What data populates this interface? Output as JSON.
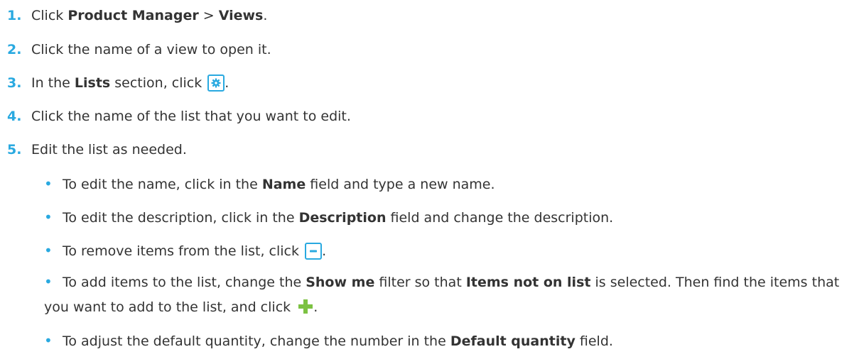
{
  "steps": [
    {
      "num": "1.",
      "text1": "Click ",
      "b1": "Product Manager",
      "text2": " > ",
      "b2": "Views",
      "text3": "."
    },
    {
      "num": "2.",
      "text": "Click the name of a view to open it."
    },
    {
      "num": "3.",
      "text1": "In the ",
      "b1": "Lists",
      "text2": " section, click ",
      "text3": "."
    },
    {
      "num": "4.",
      "text": "Click the name of the list that you want to edit."
    },
    {
      "num": "5.",
      "text": "Edit the list as needed."
    }
  ],
  "bullets": [
    {
      "text1": "To edit the name, click in the ",
      "b1": "Name",
      "text2": " field and type a new name."
    },
    {
      "text1": "To edit the description, click in the ",
      "b1": "Description",
      "text2": " field and change the description."
    },
    {
      "text1": "To remove items from the list, click ",
      "text2": "."
    },
    {
      "text1": "To add items to the list, change the ",
      "b1": "Show me",
      "text2": " filter so that ",
      "b2": "Items not on list",
      "text3": " is selected. Then find the items that you want to add to the list, and click ",
      "text4": "."
    },
    {
      "text1": "To adjust the default quantity, change the number in the ",
      "b1": "Default quantity",
      "text2": " field."
    }
  ],
  "bullet_char": "•",
  "icons": {
    "gear": "gear-icon",
    "minus": "minus-icon",
    "plus": "plus-icon"
  },
  "colors": {
    "accent": "#29a9e0",
    "plus": "#7cc242",
    "text": "#333333"
  }
}
